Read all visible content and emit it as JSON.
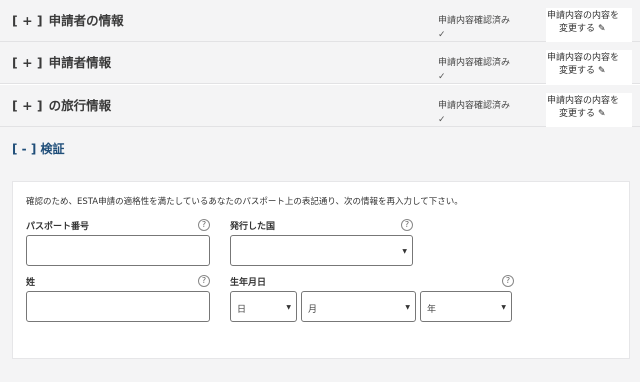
{
  "sections": [
    {
      "bracket": "[ + ]",
      "title": "申請者の情報",
      "status": "申請内容確認済み",
      "check": "✓",
      "change_line1": "申請内容の内容を",
      "change_line2": "変更する"
    },
    {
      "bracket": "[ + ]",
      "title": "申請者情報",
      "status": "申請内容確認済み",
      "check": "✓",
      "change_line1": "申請内容の内容を",
      "change_line2": "変更する"
    },
    {
      "bracket": "[ + ]",
      "title": "の旅行情報",
      "status": "申請内容確認済み",
      "check": "✓",
      "change_line1": "申請内容の内容を",
      "change_line2": "変更する"
    }
  ],
  "verify": {
    "title": "[ - ] 検証",
    "instructions": "確認のため、ESTA申請の適格性を満たしているあなたのパスポート上の表記通り、次の情報を再入力して下さい。",
    "passport_label": "パスポート番号",
    "country_label": "発行した国",
    "surname_label": "姓",
    "dob_label": "生年月日",
    "day_placeholder": "日",
    "month_placeholder": "月",
    "year_placeholder": "年",
    "help_glyph": "?"
  },
  "icons": {
    "pencil": "pencil-icon",
    "dropdown": "chevron-down-icon",
    "help": "help-icon",
    "check": "check-icon"
  }
}
